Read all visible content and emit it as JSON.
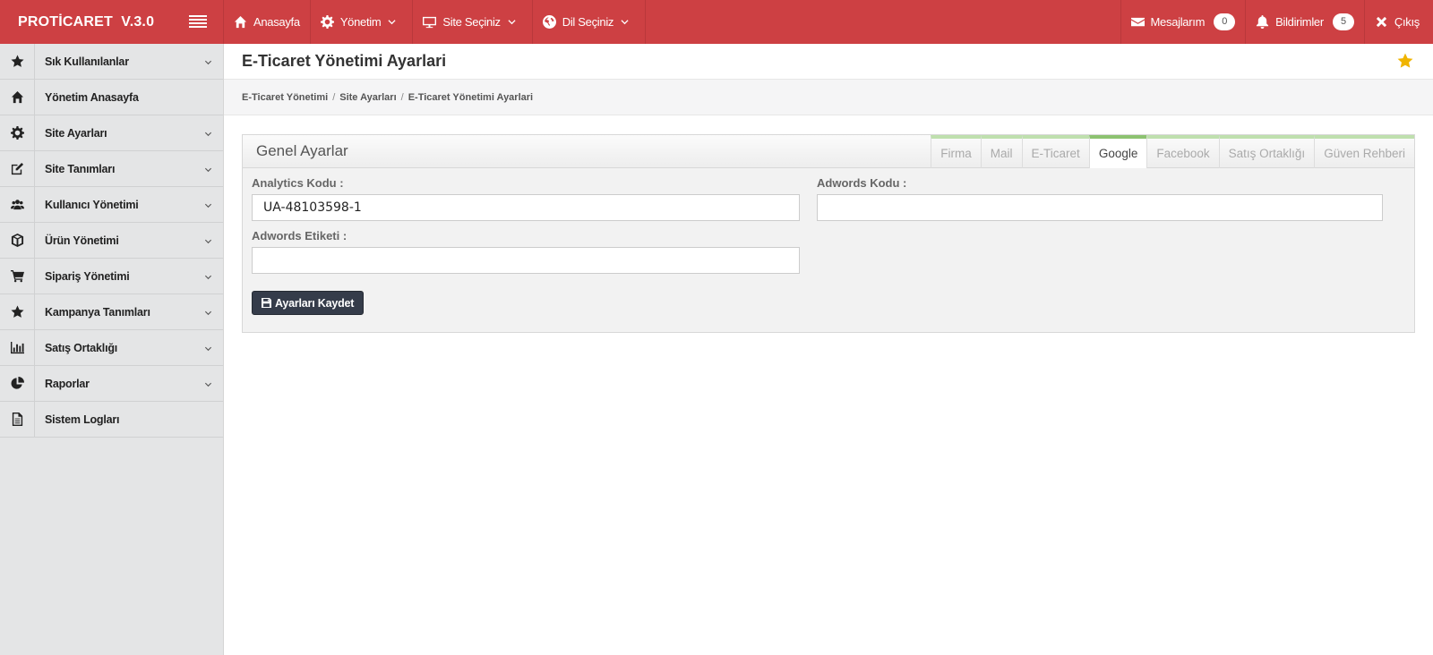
{
  "brand": {
    "name": "PROTİCARET  V.3.0"
  },
  "topnav": {
    "home": "Anasayfa",
    "management": "Yönetim",
    "site_select": "Site Seçiniz",
    "lang_select": "Dil Seçiniz",
    "messages": "Mesajlarım",
    "messages_count": "0",
    "notifications": "Bildirimler",
    "notifications_count": "5",
    "logout": "Çıkış"
  },
  "sidebar": {
    "items": [
      {
        "label": "Sık Kullanılanlar",
        "icon": "star-icon"
      },
      {
        "label": "Yönetim Anasayfa",
        "icon": "home-icon"
      },
      {
        "label": "Site Ayarları",
        "icon": "gear-icon"
      },
      {
        "label": "Site Tanımları",
        "icon": "edit-icon"
      },
      {
        "label": "Kullanıcı Yönetimi",
        "icon": "users-icon"
      },
      {
        "label": "Ürün Yönetimi",
        "icon": "box-icon"
      },
      {
        "label": "Sipariş Yönetimi",
        "icon": "cart-icon"
      },
      {
        "label": "Kampanya Tanımları",
        "icon": "star-icon"
      },
      {
        "label": "Satış Ortaklığı",
        "icon": "bar-chart-icon"
      },
      {
        "label": "Raporlar",
        "icon": "pie-chart-icon"
      },
      {
        "label": "Sistem Logları",
        "icon": "file-icon"
      }
    ]
  },
  "page": {
    "title": "E-Ticaret Yönetimi Ayarlari",
    "breadcrumb": [
      "E-Ticaret Yönetimi",
      "Site Ayarları",
      "E-Ticaret Yönetimi Ayarlari"
    ]
  },
  "panel": {
    "title": "Genel Ayarlar",
    "tabs": [
      "Firma",
      "Mail",
      "E-Ticaret",
      "Google",
      "Facebook",
      "Satış Ortaklığı",
      "Güven Rehberi"
    ],
    "active_tab": "Google"
  },
  "form": {
    "analytics_label": "Analytics Kodu :",
    "analytics_value": "UA-48103598-1",
    "adwords_code_label": "Adwords Kodu :",
    "adwords_code_value": "",
    "adwords_label_label": "Adwords Etiketi :",
    "adwords_label_value": "",
    "save_label": "Ayarları Kaydet"
  },
  "colors": {
    "topbar": "#cd4043",
    "sidebar": "#e4e5e6",
    "tab_accent": "#8cc270",
    "save_button": "#353c4a",
    "star": "#f0b400"
  }
}
